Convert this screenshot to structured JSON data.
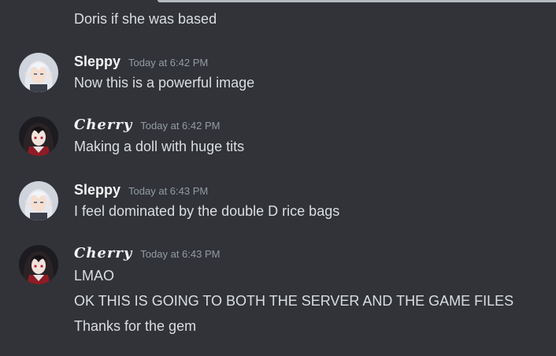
{
  "messages": [
    {
      "continuation": true,
      "lines": [
        "Doris if she was based"
      ]
    },
    {
      "username": "Sleppy",
      "avatar_icon": "silver-hair-anime-avatar",
      "timestamp": "Today at 6:42 PM",
      "lines": [
        "Now this is a powerful image"
      ]
    },
    {
      "username": "Cherry",
      "avatar_icon": "dark-hair-anime-avatar",
      "timestamp": "Today at 6:42 PM",
      "lines": [
        "Making a doll with huge tits"
      ]
    },
    {
      "username": "Sleppy",
      "avatar_icon": "silver-hair-anime-avatar",
      "timestamp": "Today at 6:43 PM",
      "lines": [
        "I feel dominated by the double D rice bags"
      ]
    },
    {
      "username": "Cherry",
      "avatar_icon": "dark-hair-anime-avatar",
      "timestamp": "Today at 6:43 PM",
      "lines": [
        "LMAO",
        "OK THIS IS GOING TO BOTH THE SERVER AND THE GAME FILES",
        "Thanks for the gem"
      ]
    }
  ],
  "colors": {
    "background": "#313338",
    "text": "#dbdee1",
    "username": "#f2f3f5",
    "timestamp": "#949ba4"
  }
}
